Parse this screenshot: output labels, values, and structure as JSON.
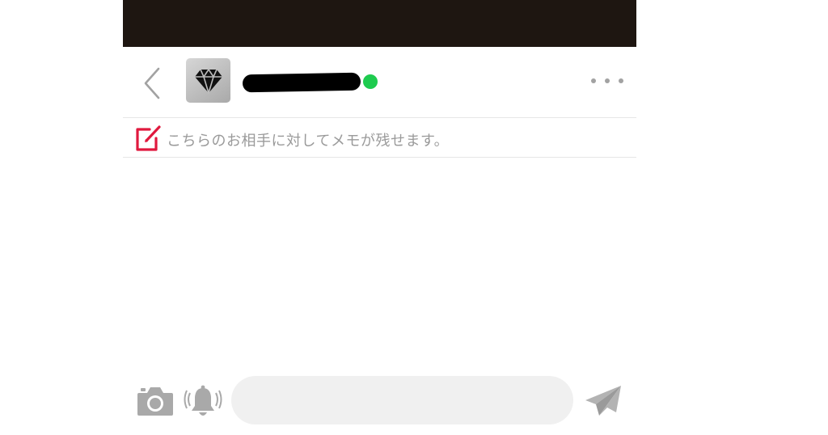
{
  "header": {
    "back_icon": "chevron-left-icon",
    "avatar_icon": "diamond-icon",
    "online_status_color": "#1ecb4f",
    "more_icon": "more-horizontal-icon"
  },
  "memo": {
    "icon": "edit-note-icon",
    "icon_color": "#e0193e",
    "text": "こちらのお相手に対してメモが残せます。"
  },
  "composer": {
    "camera_icon": "camera-icon",
    "bell_icon": "ringing-bell-icon",
    "input_value": "",
    "input_placeholder": "",
    "send_icon": "paper-plane-icon"
  },
  "colors": {
    "status_bar": "#1e1611",
    "icon_gray": "#a2a2a2",
    "input_bg": "#f0f0f0"
  }
}
